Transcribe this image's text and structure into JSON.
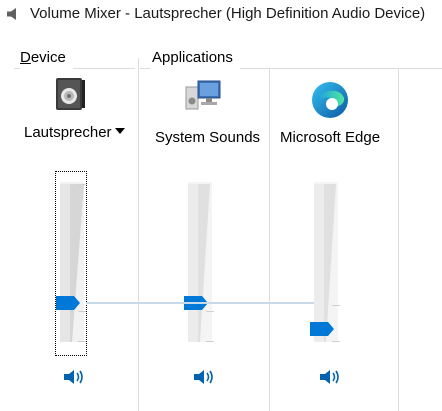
{
  "window": {
    "title": "Volume Mixer - Lautsprecher (High Definition Audio Device)"
  },
  "sections": {
    "device": "Device",
    "applications": "Applications"
  },
  "device": {
    "name": "Lautsprecher",
    "icon": "speaker-device-icon",
    "volume_fraction": 0.25,
    "muted": false
  },
  "apps": [
    {
      "name": "System Sounds",
      "icon": "system-sounds-icon",
      "volume_fraction": 0.25,
      "muted": false
    },
    {
      "name": "Microsoft Edge",
      "icon": "edge-icon",
      "volume_fraction": 0.08,
      "muted": false
    }
  ],
  "colors": {
    "accent": "#0078d7",
    "track": "#eeeeee",
    "peak_line": "#c8d9ea",
    "separator": "#dcdcdc"
  }
}
